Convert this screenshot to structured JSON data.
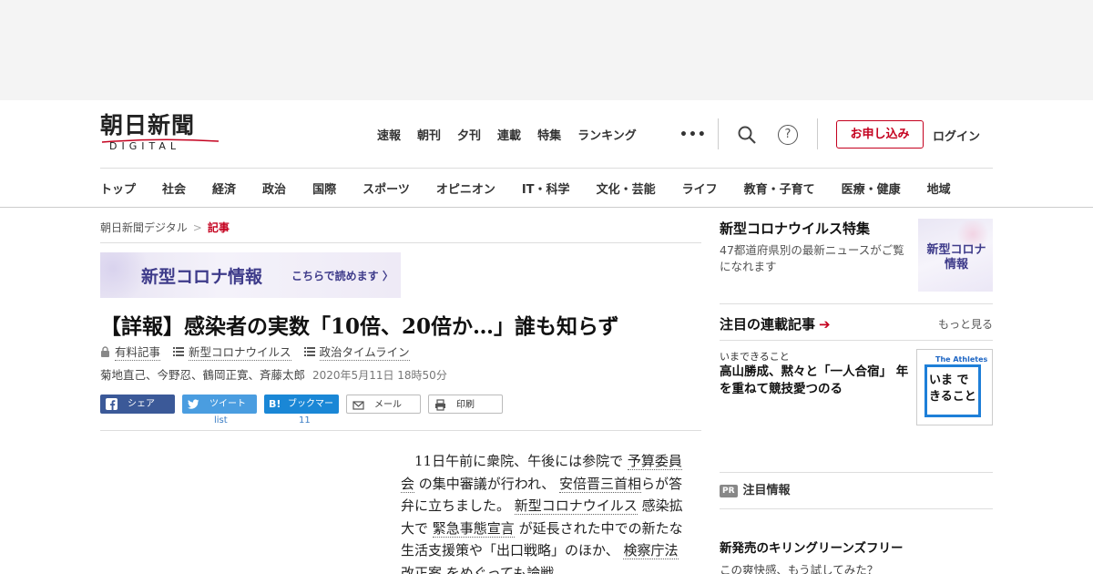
{
  "brand": {
    "logo_kanji": "朝日新聞",
    "logo_sub": "DIGITAL",
    "accent_color": "#c4001e"
  },
  "top_nav": [
    "速報",
    "朝刊",
    "夕刊",
    "連載",
    "特集",
    "ランキング"
  ],
  "header_actions": {
    "more": "•••",
    "help": "?",
    "apply": "お申し込み",
    "login": "ログイン"
  },
  "category_nav": [
    "トップ",
    "社会",
    "経済",
    "政治",
    "国際",
    "スポーツ",
    "オピニオン",
    "IT・科学",
    "文化・芸能",
    "ライフ",
    "教育・子育て",
    "医療・健康",
    "地域"
  ],
  "breadcrumb": {
    "root": "朝日新聞デジタル",
    "separator": ">",
    "current": "記事"
  },
  "corona_banner": {
    "title": "新型コロナ情報",
    "cta": "こちらで読めます 〉"
  },
  "article": {
    "headline": "【詳報】感染者の実数「10倍、20倍か…」誰も知らず",
    "tags": [
      "有料記事",
      "新型コロナウイルス",
      "政治タイムライン"
    ],
    "authors": "菊地直己、今野忍、鶴岡正寛、斉藤太郎",
    "date": "2020年5月11日 18時50分",
    "body": {
      "p1": "11日午前に衆院、午後には参院で",
      "l1": "予算委員会",
      "p2": "の集中審議が行われ、",
      "l2": "安倍晋三首相",
      "p3": "らが答弁に立ちました。",
      "l3": "新型コロナウイルス",
      "p4": "感染拡大で",
      "l4": "緊急事態宣言",
      "p5": "が延長された中での新たな生活支援策や「出口戦略」のほか、",
      "l5": "検察庁法改正案",
      "p6": "をめぐっても論戦"
    }
  },
  "share": {
    "facebook": "シェア",
    "twitter": "ツイート",
    "hatena": "ブックマーク",
    "hatena_mark": "B!",
    "mail": "メール",
    "print": "印刷",
    "twitter_count": "list",
    "hatena_count": "11"
  },
  "sidebar": {
    "corona": {
      "title": "新型コロナウイルス特集",
      "desc": "47都道府県別の最新ニュースがご覧になれます",
      "thumb_text": "新型コロナ 情報"
    },
    "series": {
      "title": "注目の連載記事",
      "arrow": "➔",
      "more": "もっと見る",
      "item_name": "いまできること",
      "item_title": "高山勝成、黙々と「一人合宿」 年を重ねて競技愛つのる",
      "thumb_tag": "The Athletes",
      "thumb_text": "いま できること"
    },
    "pr": {
      "badge": "PR",
      "label": "注目情報"
    },
    "ad": {
      "title": "新発売のキリングリーンズフリー",
      "sub": "この爽快感、もう試してみた？"
    }
  }
}
